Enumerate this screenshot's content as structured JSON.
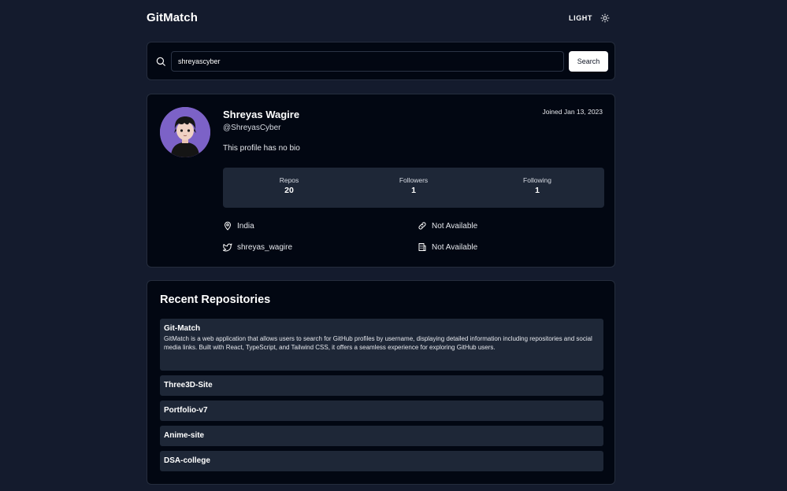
{
  "header": {
    "logo": "GitMatch",
    "theme_label": "LIGHT",
    "theme_icon": "sun-icon"
  },
  "search": {
    "value": "shreyascyber",
    "button_label": "Search",
    "icon": "search-icon"
  },
  "profile": {
    "name": "Shreyas Wagire",
    "handle": "@ShreyasCyber",
    "bio": "This profile has no bio",
    "joined": "Joined Jan 13, 2023",
    "stats": [
      {
        "label": "Repos",
        "value": "20"
      },
      {
        "label": "Followers",
        "value": "1"
      },
      {
        "label": "Following",
        "value": "1"
      }
    ],
    "location": "India",
    "blog": "Not Available",
    "twitter": "shreyas_wagire",
    "company": "Not Available"
  },
  "repositories": {
    "heading": "Recent Repositories",
    "items": [
      {
        "name": "Git-Match",
        "description": "GitMatch is a web application that allows users to search for GitHub profiles by username, displaying detailed information including repositories and social media links. Built with React, TypeScript, and Tailwind CSS, it offers a seamless experience for exploring GitHub users."
      },
      {
        "name": "Three3D-Site"
      },
      {
        "name": "Portfolio-v7"
      },
      {
        "name": "Anime-site"
      },
      {
        "name": "DSA-college"
      }
    ]
  },
  "colors": {
    "page_background": "#141b2d",
    "card_background": "#020712",
    "panel_background": "#1e2737",
    "avatar_background": "#7c62c7"
  }
}
